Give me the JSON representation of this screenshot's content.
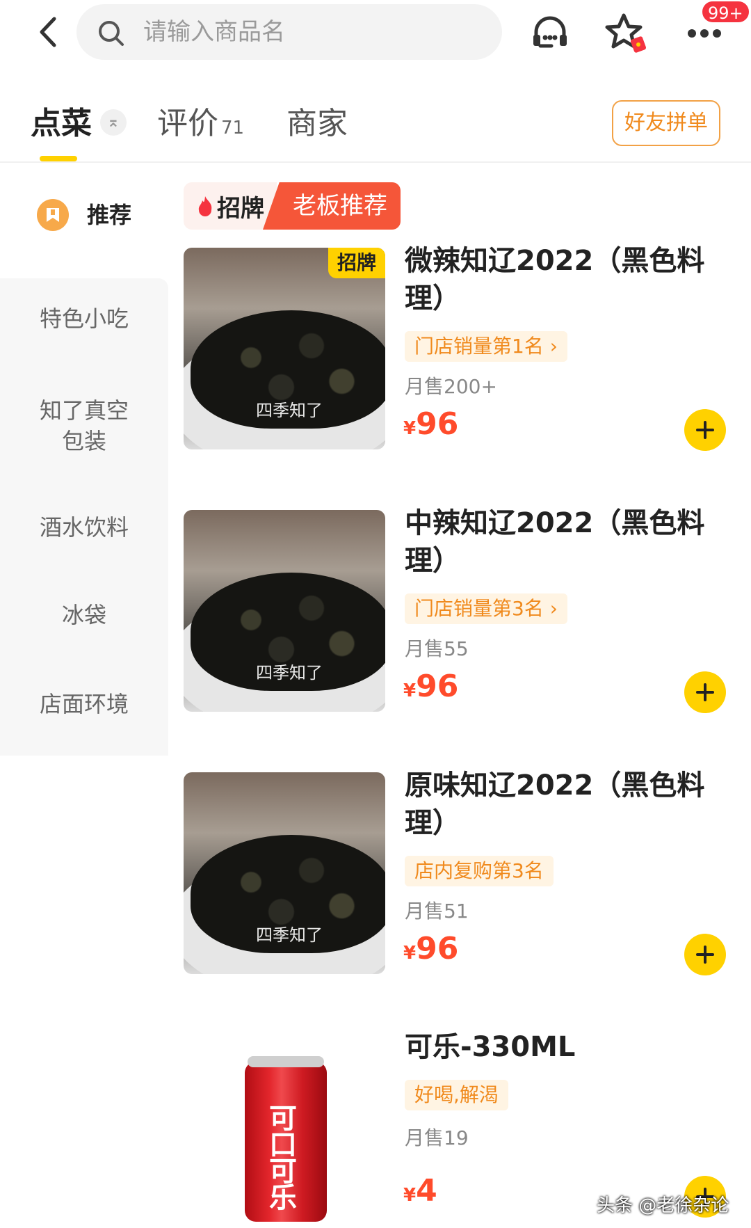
{
  "search": {
    "placeholder": "请输入商品名"
  },
  "header": {
    "badge": "99+"
  },
  "tabs": {
    "order": "点菜",
    "review": "评价",
    "review_count": "71",
    "shop": "商家",
    "collapse": "⌅",
    "group_order": "好友拼单"
  },
  "sidebar": {
    "active": "推荐",
    "items": [
      {
        "label": "特色小吃"
      },
      {
        "label": "知了真空包装"
      },
      {
        "label": "酒水饮料"
      },
      {
        "label": "冰袋"
      },
      {
        "label": "店面环境"
      }
    ]
  },
  "section_tag": {
    "left": "招牌",
    "right": "老板推荐"
  },
  "products": [
    {
      "title": "微辣知辽2022（黑色料理）",
      "badge": "招牌",
      "rank": "门店销量第1名 ›",
      "monthly": "月售200+",
      "currency": "¥",
      "price": "96",
      "watermark": "四季知了"
    },
    {
      "title": "中辣知辽2022（黑色料理）",
      "rank": "门店销量第3名 ›",
      "monthly": "月售55",
      "currency": "¥",
      "price": "96",
      "watermark": "四季知了"
    },
    {
      "title": "原味知辽2022（黑色料理）",
      "rank": "店内复购第3名",
      "monthly": "月售51",
      "currency": "¥",
      "price": "96",
      "watermark": "四季知了"
    },
    {
      "title": "可乐-330ML",
      "rank": "好喝,解渴",
      "monthly": "月售19",
      "currency": "¥",
      "price": "4",
      "can_text": "可口可乐"
    }
  ],
  "footer": {
    "watermark": "头条 @老徐杂论"
  },
  "colors": {
    "accent": "#ffd100",
    "price": "#ff4b2b",
    "tag_red": "#f55639",
    "rank_orange": "#f08a1d"
  }
}
